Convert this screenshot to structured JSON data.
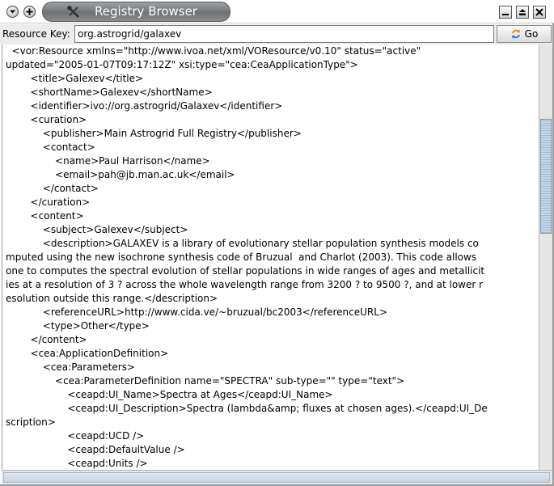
{
  "window": {
    "title": "Registry Browser",
    "title_icon": "tools-icon"
  },
  "toolbar": {
    "resource_key_label": "Resource Key:",
    "resource_key_value": "org.astrogrid/galaxev",
    "go_label": "Go",
    "go_icon": "refresh-arrows-icon"
  },
  "xml_lines": [
    "  <vor:Resource xmlns=\"http://www.ivoa.net/xml/VOResource/v0.10\" status=\"active\"",
    "updated=\"2005-01-07T09:17:12Z\" xsi:type=\"cea:CeaApplicationType\">",
    "        <title>Galexev</title>",
    "        <shortName>Galexev</shortName>",
    "        <identifier>ivo://org.astrogrid/Galaxev</identifier>",
    "        <curation>",
    "            <publisher>Main Astrogrid Full Registry</publisher>",
    "            <contact>",
    "                <name>Paul Harrison</name>",
    "                <email>pah@jb.man.ac.uk</email>",
    "            </contact>",
    "        </curation>",
    "        <content>",
    "            <subject>Galexev</subject>",
    "            <description>GALAXEV is a library of evolutionary stellar population synthesis models co",
    "mputed using the new isochrone synthesis code of Bruzual  and Charlot (2003). This code allows",
    "one to computes the spectral evolution of stellar populations in wide ranges of ages and metallicit",
    "ies at a resolution of 3 ? across the whole wavelength range from 3200 ? to 9500 ?, and at lower r",
    "esolution outside this range.</description>",
    "            <referenceURL>http://www.cida.ve/~bruzual/bc2003</referenceURL>",
    "            <type>Other</type>",
    "        </content>",
    "        <cea:ApplicationDefinition>",
    "            <cea:Parameters>",
    "                <cea:ParameterDefinition name=\"SPECTRA\" sub-type=\"\" type=\"text\">",
    "                    <ceapd:UI_Name>Spectra at Ages</ceapd:UI_Name>",
    "                    <ceapd:UI_Description>Spectra (lambda&amp; fluxes at chosen ages).</ceapd:UI_De",
    "scription>",
    "                    <ceapd:UCD />",
    "                    <ceapd:DefaultValue />",
    "                    <ceapd:Units />"
  ]
}
